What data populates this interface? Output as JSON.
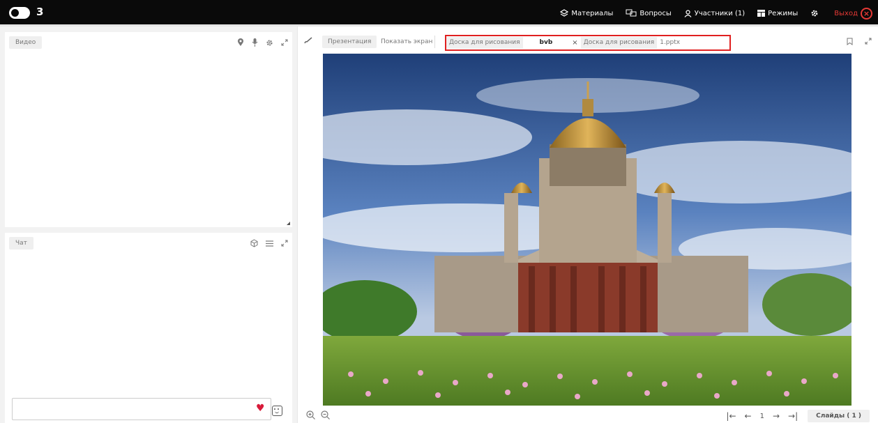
{
  "topbar": {
    "room_number": "3",
    "nav": {
      "materials": "Материалы",
      "questions": "Вопросы",
      "participants": "Участники (1)",
      "modes": "Режимы",
      "exit": "Выход"
    }
  },
  "video_panel": {
    "tab_label": "Видео"
  },
  "chat_panel": {
    "tab_label": "Чат",
    "input_value": ""
  },
  "toolbar": {
    "presentation": "Презентация",
    "share_screen": "Показать экран",
    "tabs": [
      {
        "label": "Доска для рисования"
      },
      {
        "label": "bvb"
      },
      {
        "label": "Доска для рисования"
      },
      {
        "label": "1.pptx"
      }
    ],
    "close_symbol": "×"
  },
  "pager": {
    "first": "|←",
    "prev": "←",
    "page": "1",
    "next": "→",
    "last": "→|",
    "slides_label": "Слайды ( 1 )"
  },
  "colors": {
    "topbar_bg": "#0a0a0a",
    "exit": "#e53935",
    "highlight_border": "#e02020",
    "heart": "#d81b3a"
  }
}
